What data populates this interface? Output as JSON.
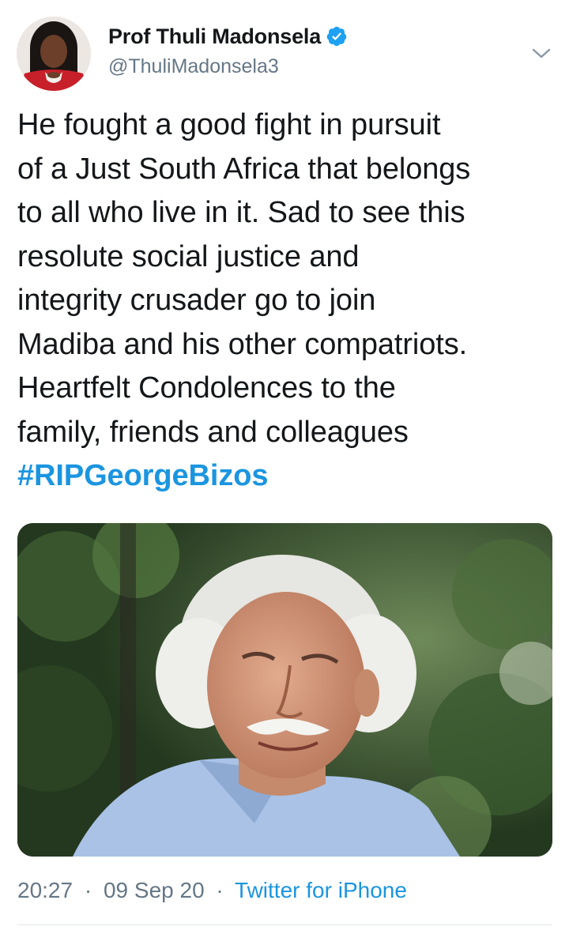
{
  "author": {
    "display_name": "Prof Thuli Madonsela",
    "handle": "@ThuliMadonsela3",
    "verified": true,
    "avatar_icon": "profile-photo"
  },
  "tweet": {
    "lines": [
      "He fought a good fight in pursuit",
      "of a Just South Africa that belongs",
      "to all who live in it. Sad to see this",
      "resolute social justice and",
      "integrity crusader go to join",
      "Madiba and his other compatriots.",
      "Heartfelt Condolences to the",
      "family, friends and colleagues"
    ],
    "hashtag": "#RIPGeorgeBizos"
  },
  "media": {
    "icon": "photo-elderly-man-white-hair"
  },
  "meta": {
    "time": "20:27",
    "date": "09 Sep 20",
    "separator": "·",
    "source": "Twitter for iPhone"
  },
  "colors": {
    "text": "#14171a",
    "secondary": "#657786",
    "link": "#1b95e0",
    "divider": "#e1e8ed"
  },
  "icons": {
    "verified": "verified-badge-icon",
    "menu": "chevron-down-icon"
  }
}
